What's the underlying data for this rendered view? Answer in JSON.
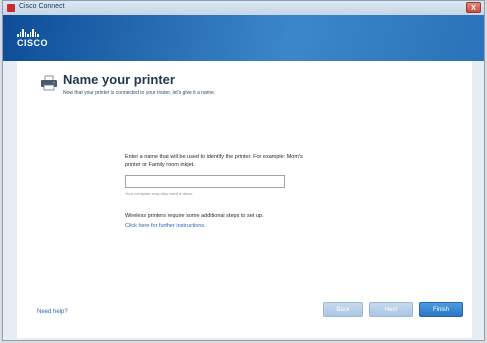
{
  "window": {
    "title": "Cisco Connect",
    "close_label": "X"
  },
  "brand": {
    "logo_text": "CISCO"
  },
  "page": {
    "title": "Name your printer",
    "subtitle": "Now that your printer is connected to your router, let's give it a name."
  },
  "form": {
    "instructions": "Enter a name that will be used to identify the printer. For example: Mom's printer or Family room inkjet.",
    "name_value": "",
    "name_placeholder": "",
    "hint": "Your computer may also need a driver."
  },
  "note": {
    "text": "Wireless printers require some additional steps to set up.",
    "link": "Click here for further instructions."
  },
  "footer": {
    "help_link": "Need help?",
    "back_label": "Back",
    "next_label": "Next",
    "finish_label": "Finish"
  },
  "colors": {
    "header_blue": "#2a6fb6",
    "link_blue": "#2a67b4",
    "finish_button": "#2a77c5",
    "disabled_button": "#a9c6e4"
  },
  "icons": {
    "app": "cisco-app-icon",
    "close": "close-icon",
    "printer": "printer-icon"
  }
}
